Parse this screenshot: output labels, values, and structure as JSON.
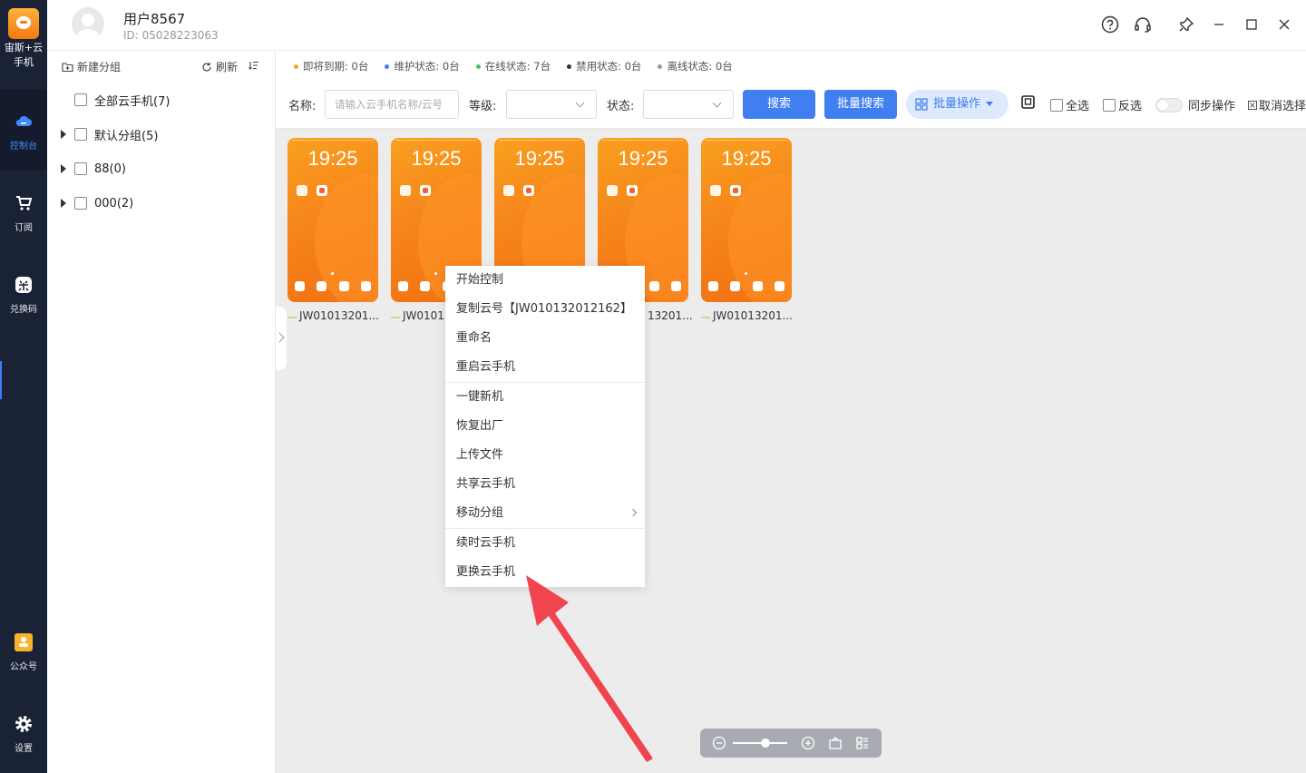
{
  "app": {
    "logo_text": "宙斯+云\n手机"
  },
  "nav": {
    "items": [
      {
        "label": "控制台",
        "icon": "cloud-icon"
      },
      {
        "label": "订阅",
        "icon": "cart-icon"
      },
      {
        "label": "兑换码",
        "icon": "exchange-icon"
      },
      {
        "label": "公众号",
        "icon": "wechat-official-icon"
      },
      {
        "label": "设置",
        "icon": "gear-icon"
      }
    ]
  },
  "header": {
    "username": "用户8567",
    "user_id": "ID: 05028223063"
  },
  "sidebar": {
    "new_group_label": "新建分组",
    "refresh_label": "刷新",
    "groups": [
      {
        "label": "全部云手机(7)"
      },
      {
        "label": "默认分组(5)"
      },
      {
        "label": "88(0)"
      },
      {
        "label": "000(2)"
      }
    ]
  },
  "status": {
    "items": [
      {
        "label": "即将到期: 0台",
        "color": "#f5a623"
      },
      {
        "label": "维护状态: 0台",
        "color": "#3f7ff0"
      },
      {
        "label": "在线状态: 7台",
        "color": "#4cc16a"
      },
      {
        "label": "禁用状态: 0台",
        "color": "#333333"
      },
      {
        "label": "离线状态: 0台",
        "color": "#999999"
      }
    ]
  },
  "toolbar": {
    "name_label": "名称:",
    "name_placeholder": "请输入云手机名称/云号",
    "level_label": "等级:",
    "state_label": "状态:",
    "search_label": "搜索",
    "batch_search_label": "批量搜索",
    "batch_op_label": "批量操作",
    "select_all_label": "全选",
    "invert_label": "反选",
    "sync_label": "同步操作",
    "cancel_select_label": "取消选择"
  },
  "phones": [
    {
      "time": "19:25",
      "name": "JW01013201..."
    },
    {
      "time": "19:25",
      "name": "JW01013"
    },
    {
      "time": "19:25",
      "name": ""
    },
    {
      "time": "19:25",
      "name": "13201..."
    },
    {
      "time": "19:25",
      "name": "JW01013201..."
    }
  ],
  "context_menu": {
    "items": [
      "开始控制",
      "复制云号【JW010132012162】",
      "重命名",
      "重启云手机",
      "一键新机",
      "恢复出厂",
      "上传文件",
      "共享云手机",
      "移动分组",
      "续时云手机",
      "更换云手机"
    ]
  },
  "colors": {
    "nav_bg": "#1a2236",
    "primary": "#3f7ff0",
    "annotation_arrow": "#f0444f"
  }
}
